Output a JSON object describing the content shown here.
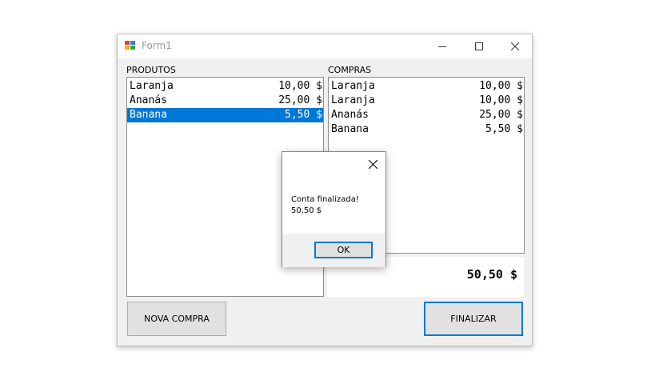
{
  "window": {
    "title": "Form1"
  },
  "produtos": {
    "label": "PRODUTOS",
    "items": [
      {
        "name": "Laranja",
        "price": "10,00 $",
        "selected": false
      },
      {
        "name": "Ananás",
        "price": "25,00 $",
        "selected": false
      },
      {
        "name": "Banana",
        "price": " 5,50 $",
        "selected": true
      }
    ]
  },
  "compras": {
    "label": "COMPRAS",
    "items": [
      {
        "name": "Laranja",
        "price": "10,00 $"
      },
      {
        "name": "Laranja",
        "price": "10,00 $"
      },
      {
        "name": "Ananás",
        "price": "25,00 $"
      },
      {
        "name": "Banana",
        "price": " 5,50 $"
      }
    ]
  },
  "total": "50,50 $",
  "buttons": {
    "nova_compra": "NOVA COMPRA",
    "finalizar": "FINALIZAR"
  },
  "dialog": {
    "line1": "Conta finalizada!",
    "line2": "50,50 $",
    "ok": "OK"
  },
  "colors": {
    "selection": "#0078d7",
    "window_bg": "#f0f0f0"
  }
}
